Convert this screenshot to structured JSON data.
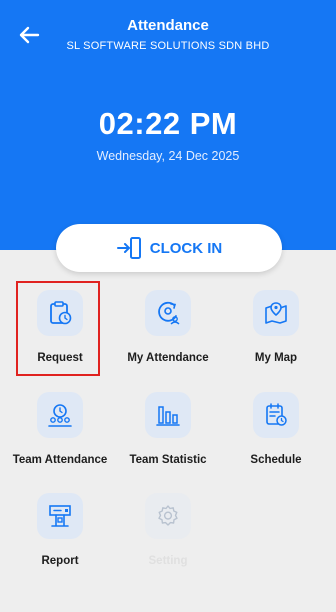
{
  "header": {
    "title": "Attendance",
    "subtitle": "SL SOFTWARE SOLUTIONS SDN BHD",
    "back_icon": "arrow-left-icon",
    "background": "#1577f4"
  },
  "clock": {
    "time": "02:22 PM",
    "date": "Wednesday, 24 Dec 2025"
  },
  "clock_in_button": {
    "label": "CLOCK IN",
    "icon": "sign-in-door-icon"
  },
  "menu": {
    "items": [
      {
        "label": "Request",
        "icon": "clipboard-clock-icon",
        "enabled": true,
        "highlighted": true
      },
      {
        "label": "My Attendance",
        "icon": "user-cycle-icon",
        "enabled": true
      },
      {
        "label": "My Map",
        "icon": "map-pin-icon",
        "enabled": true
      },
      {
        "label": "Team Attendance",
        "icon": "team-clock-icon",
        "enabled": true
      },
      {
        "label": "Team Statistic",
        "icon": "bar-chart-icon",
        "enabled": true
      },
      {
        "label": "Schedule",
        "icon": "calendar-clock-icon",
        "enabled": true
      },
      {
        "label": "Report",
        "icon": "report-icon",
        "enabled": true
      },
      {
        "label": "Setting",
        "icon": "gear-icon",
        "enabled": false
      }
    ]
  },
  "colors": {
    "accent": "#1577f4",
    "highlight": "#e0221f",
    "icon_bg": "#dfe8f5",
    "background": "#eeeeee"
  }
}
